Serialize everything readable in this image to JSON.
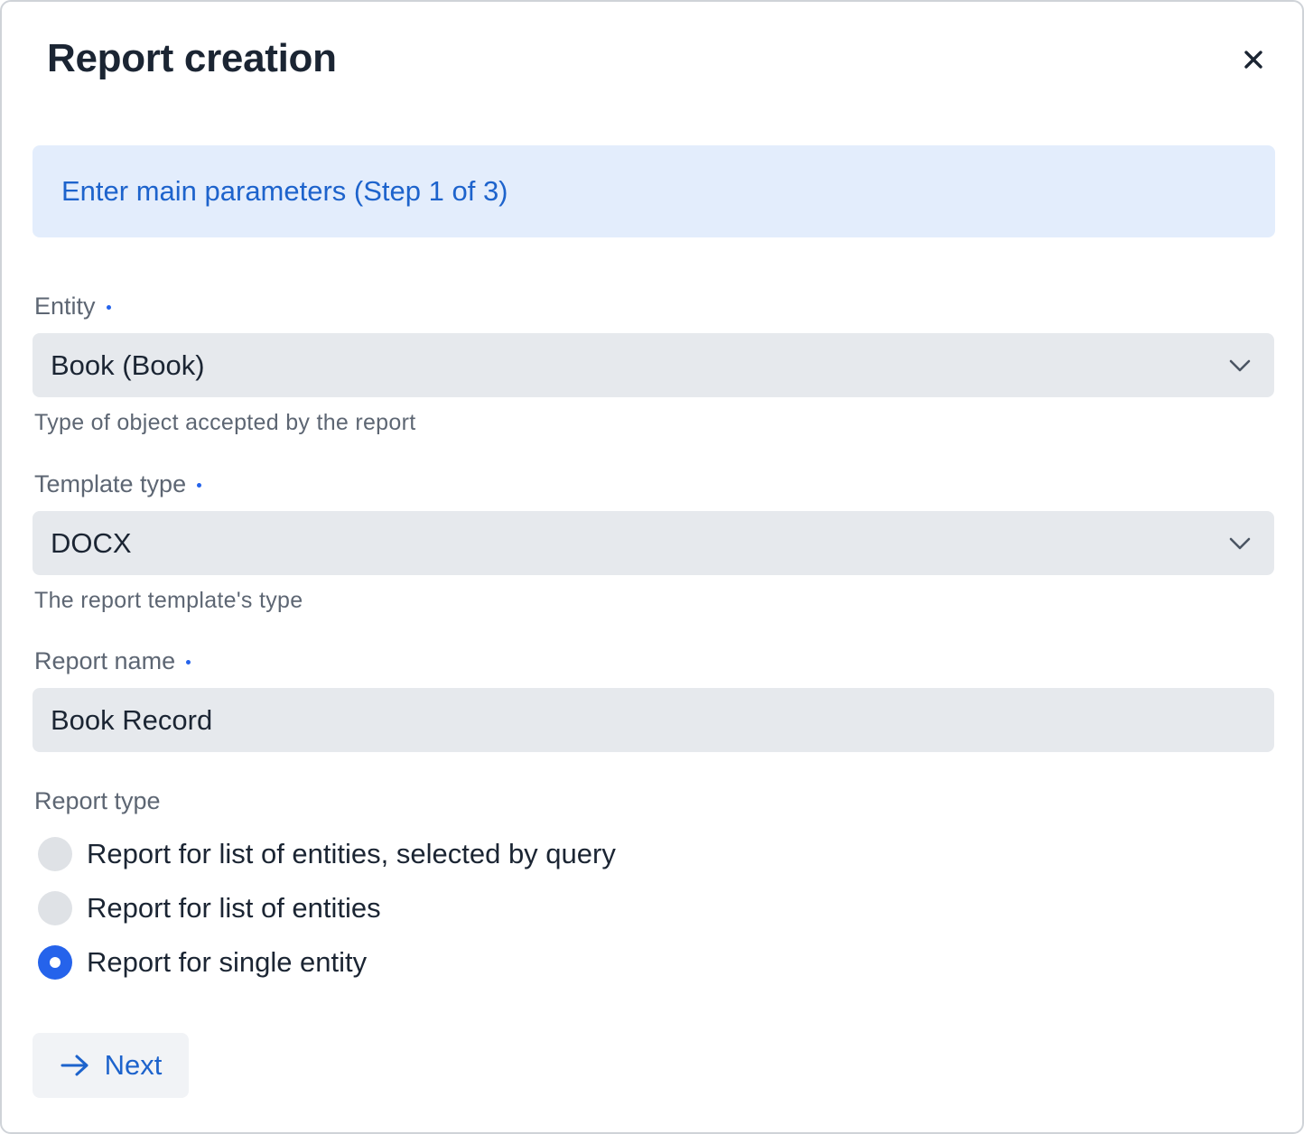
{
  "dialog": {
    "title": "Report creation",
    "close_icon": "close-icon"
  },
  "banner": {
    "text": "Enter main parameters (Step 1 of 3)"
  },
  "fields": {
    "entity": {
      "label": "Entity",
      "required": true,
      "value": "Book (Book)",
      "hint": "Type of object accepted by the report"
    },
    "template_type": {
      "label": "Template type",
      "required": true,
      "value": "DOCX",
      "hint": "The report template's type"
    },
    "report_name": {
      "label": "Report name",
      "required": true,
      "value": "Book Record"
    }
  },
  "report_type": {
    "label": "Report type",
    "options": [
      {
        "label": "Report for list of entities, selected by query",
        "checked": false
      },
      {
        "label": "Report for list of entities",
        "checked": false
      },
      {
        "label": "Report for single entity",
        "checked": true
      }
    ]
  },
  "actions": {
    "next_label": "Next",
    "next_icon": "arrow-right-icon"
  },
  "colors": {
    "accent": "#2563eb",
    "banner_bg": "#e3edfc",
    "field_bg": "#e6e9ed"
  }
}
